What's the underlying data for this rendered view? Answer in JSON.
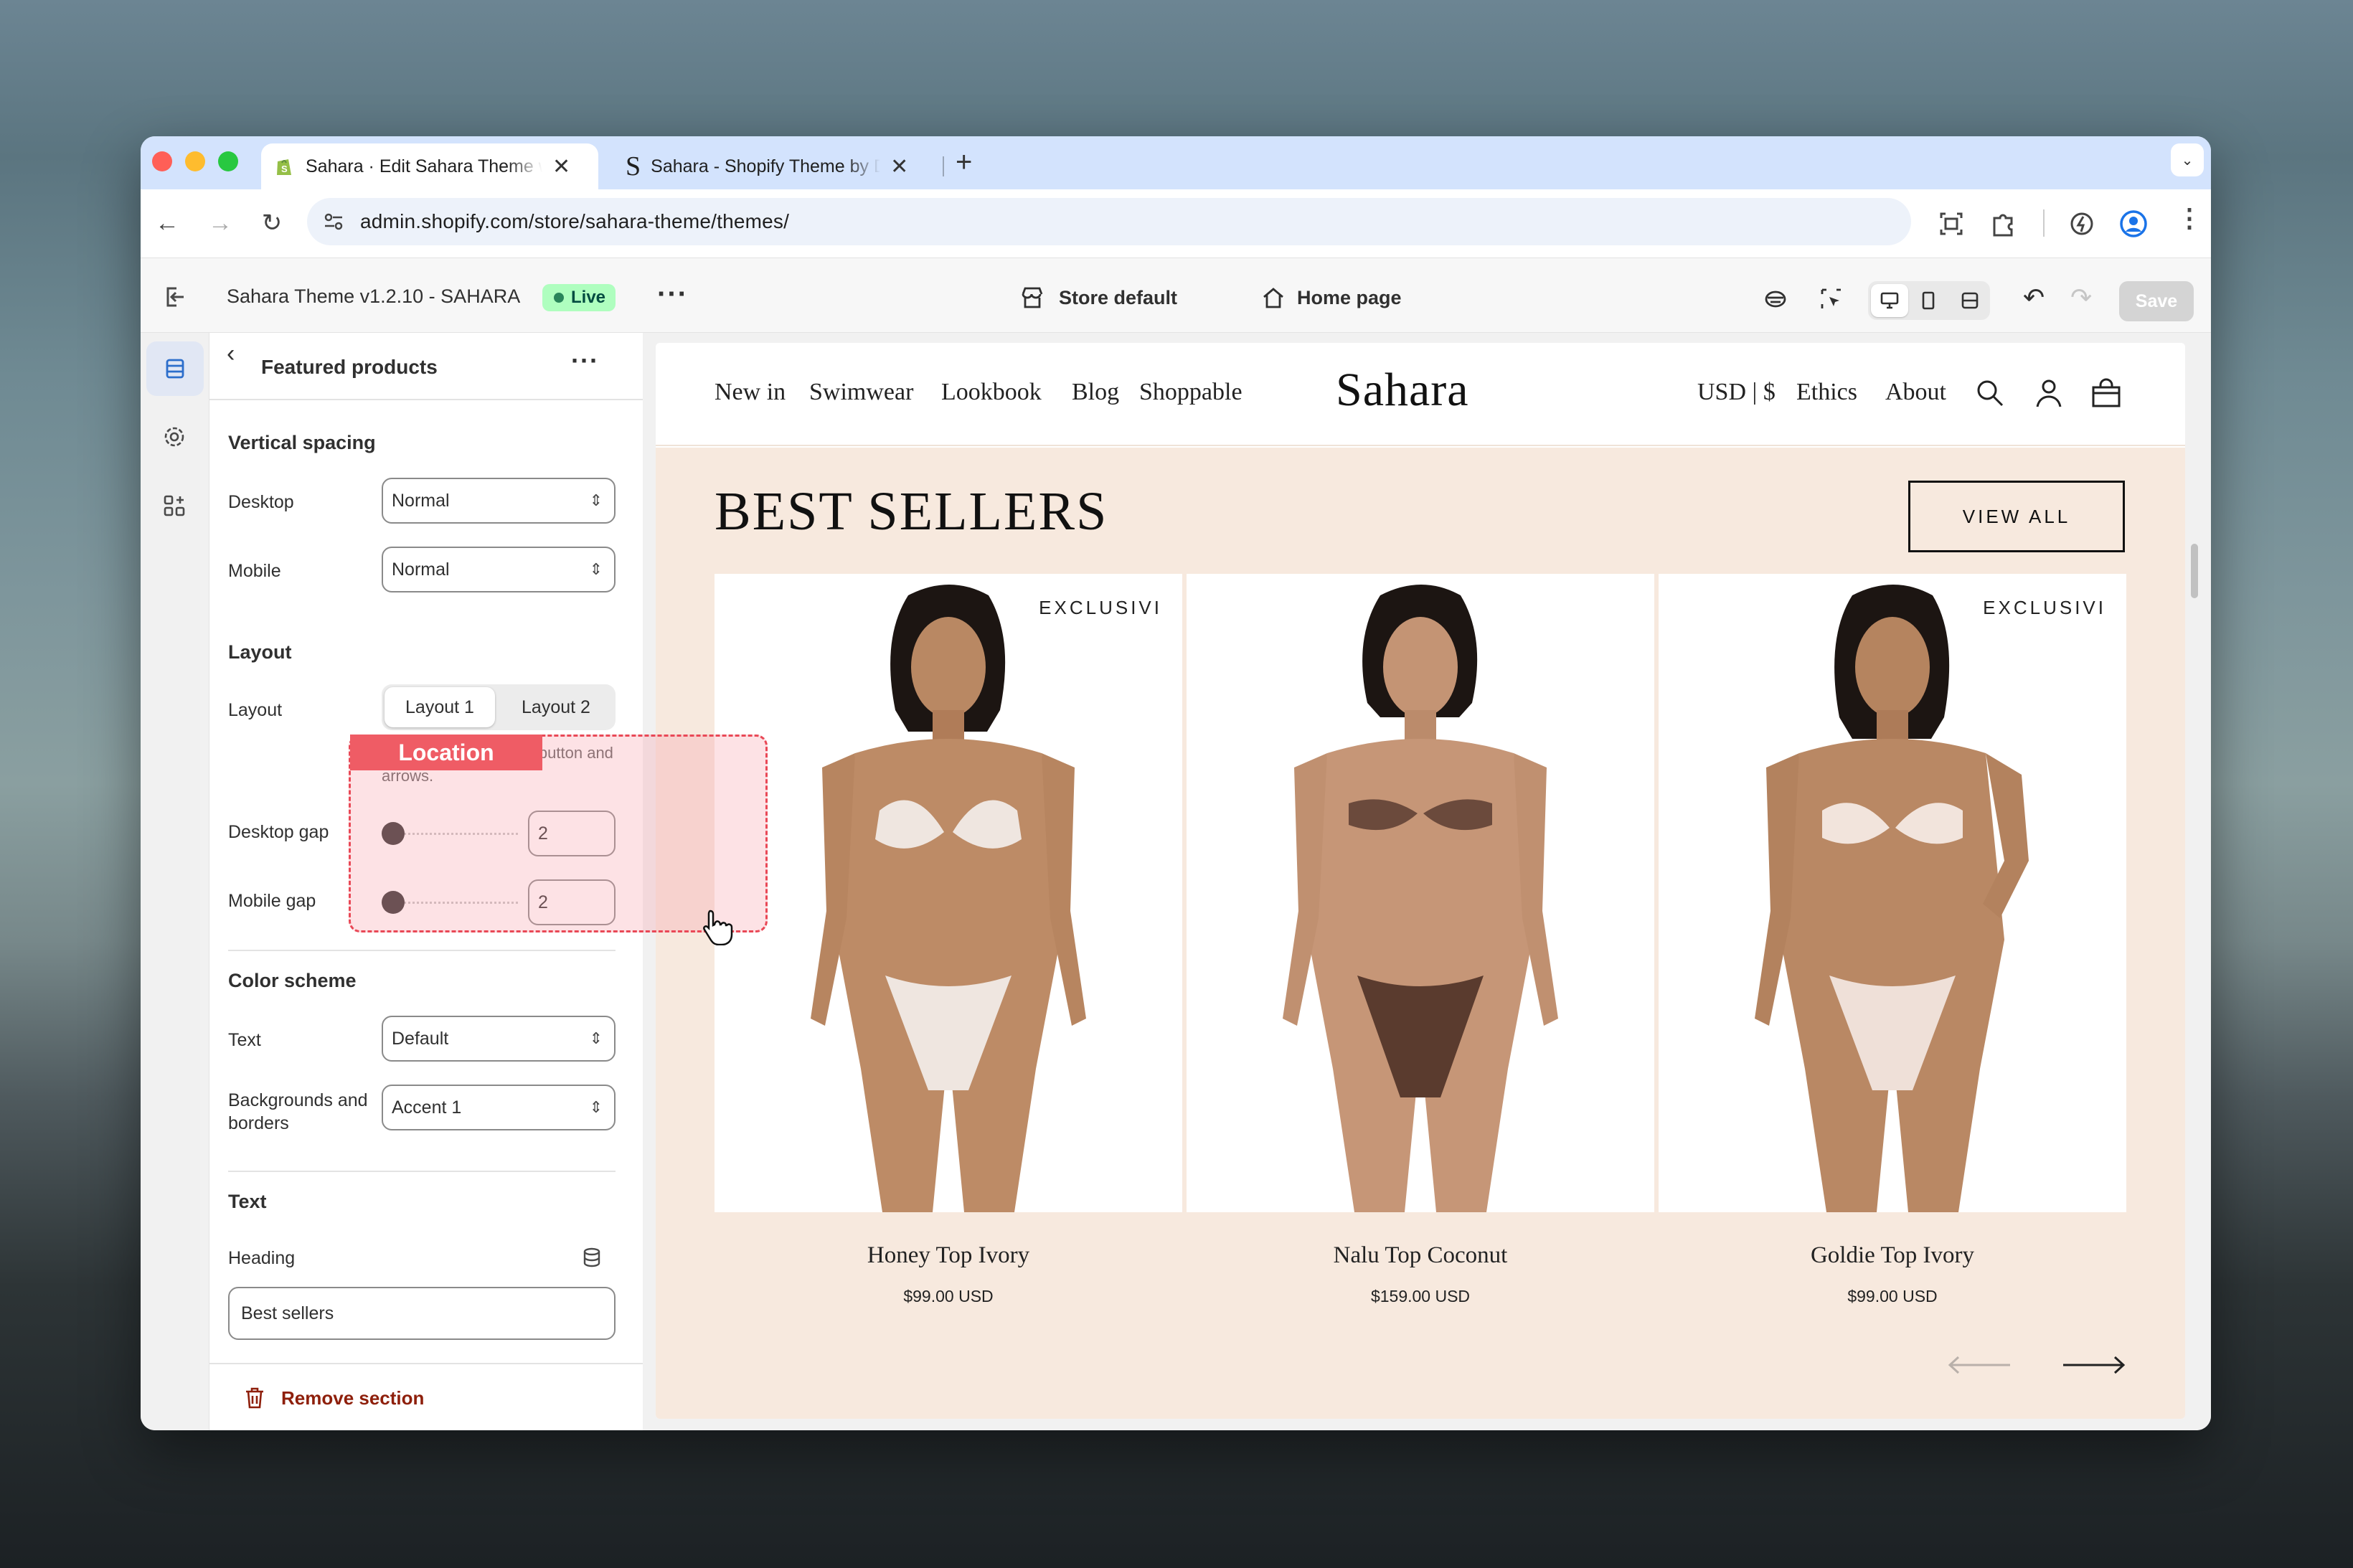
{
  "browser": {
    "tabs": [
      {
        "title": "Sahara · Edit Sahara Theme with Shopify",
        "active": true
      },
      {
        "title": "Sahara - Shopify Theme by Deux Agency",
        "active": false
      }
    ],
    "url": "admin.shopify.com/store/sahara-theme/themes/"
  },
  "editor_header": {
    "theme_name": "Sahara Theme v1.2.10 - SAHARA",
    "status": "Live",
    "store_context": "Store default",
    "page": "Home page",
    "save_label": "Save"
  },
  "panel": {
    "title": "Featured products",
    "vertical_spacing": {
      "heading": "Vertical spacing",
      "desktop_label": "Desktop",
      "desktop_value": "Normal",
      "mobile_label": "Mobile",
      "mobile_value": "Normal"
    },
    "layout": {
      "heading": "Layout",
      "label": "Layout",
      "options": [
        "Layout 1",
        "Layout 2"
      ],
      "selected": "Layout 1",
      "help": "Alignment of heading, button and arrows.",
      "desktop_gap_label": "Desktop gap",
      "desktop_gap_value": "2",
      "mobile_gap_label": "Mobile gap",
      "mobile_gap_value": "2"
    },
    "color_scheme": {
      "heading": "Color scheme",
      "text_label": "Text",
      "text_value": "Default",
      "bg_label": "Backgrounds and borders",
      "bg_value": "Accent 1"
    },
    "text": {
      "heading": "Text",
      "heading_label": "Heading",
      "heading_value": "Best sellers"
    },
    "remove_label": "Remove section"
  },
  "overlay": {
    "label": "Location"
  },
  "store": {
    "nav_left": [
      "New in",
      "Swimwear",
      "Lookbook",
      "Blog",
      "Shoppable"
    ],
    "logo": "Sahara",
    "currency": "USD | $",
    "nav_right": [
      "Ethics",
      "About"
    ],
    "section_title": "BEST SELLERS",
    "view_all": "VIEW ALL",
    "products": [
      {
        "name": "Honey Top Ivory",
        "price": "$99.00 USD",
        "badge": "EXCLUSIVI",
        "top_color": "#efe6e0",
        "bottom_color": "#efe6e0"
      },
      {
        "name": "Nalu Top Coconut",
        "price": "$159.00 USD",
        "badge": "",
        "top_color": "#6b4a3c",
        "bottom_color": "#5a3b2e"
      },
      {
        "name": "Goldie Top Ivory",
        "price": "$99.00 USD",
        "badge": "EXCLUSIVI",
        "top_color": "#f2e4dc",
        "bottom_color": "#efe0d8"
      }
    ]
  },
  "colors": {
    "shopify_green": "#95bf47",
    "live_bg": "#affebf",
    "critical": "#8e1f0b",
    "section_bg": "#f7e9de",
    "highlight": "#e94856"
  }
}
